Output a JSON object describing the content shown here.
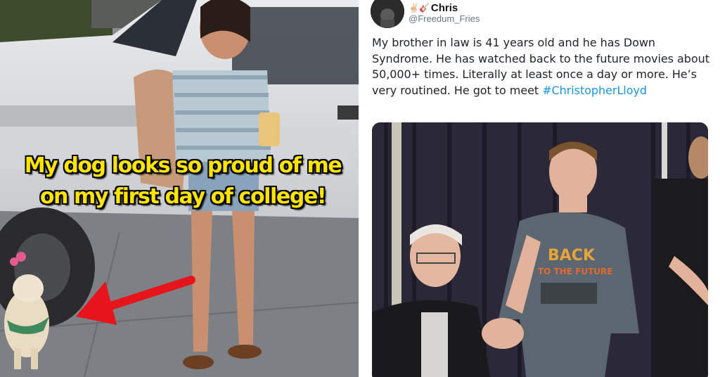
{
  "left_meme": {
    "caption_line1": "My dog looks so proud of me",
    "caption_line2": "on my first day of college!",
    "caption_color": "#ffe400",
    "arrow_color": "#e8141c"
  },
  "tweet": {
    "display_name": "Chris",
    "name_emojis": "✌🏻🎸",
    "handle": "@Freedum_Fries",
    "text": "My brother in law is 41 years old and he has Down Syndrome. He has watched back to the future movies about 50,000+ times. Literally at least once a day or more. He’s very routined. He got to meet ",
    "hashtag": "#ChristopherLloyd",
    "hashtag_color": "#1b95e0",
    "shirt_text_line1": "BACK",
    "shirt_text_line2": "TO THE FUTURE"
  }
}
